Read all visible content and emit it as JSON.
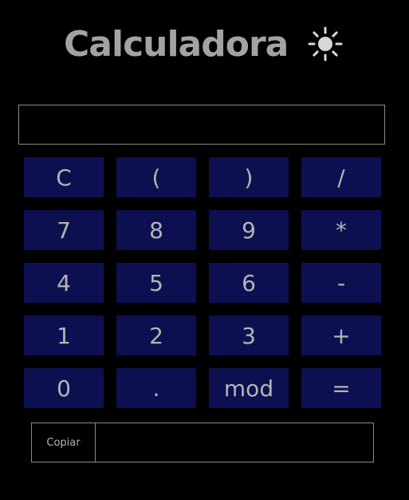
{
  "header": {
    "title": "Calculadora",
    "theme_icon": "sun-icon"
  },
  "display": {
    "value": "",
    "placeholder": ""
  },
  "keypad": {
    "keys": [
      "C",
      "(",
      ")",
      "/",
      "7",
      "8",
      "9",
      "*",
      "4",
      "5",
      "6",
      "-",
      "1",
      "2",
      "3",
      "+",
      "0",
      ".",
      "mod",
      "="
    ]
  },
  "copy": {
    "button_label": "Copiar",
    "field_value": ""
  },
  "colors": {
    "background": "#000000",
    "key_background": "#0d1050",
    "text": "#b4b4b4",
    "border": "#8a8a8a"
  }
}
